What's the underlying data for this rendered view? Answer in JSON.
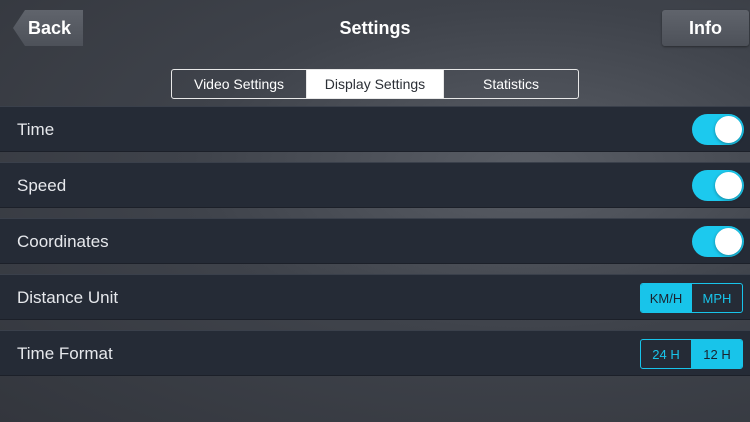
{
  "nav": {
    "back_label": "Back",
    "title": "Settings",
    "info_label": "Info"
  },
  "tabs": [
    {
      "label": "Video Settings",
      "active": false
    },
    {
      "label": "Display Settings",
      "active": true
    },
    {
      "label": "Statistics",
      "active": false
    }
  ],
  "settings": {
    "time": {
      "label": "Time",
      "enabled": true
    },
    "speed": {
      "label": "Speed",
      "enabled": true
    },
    "coordinates": {
      "label": "Coordinates",
      "enabled": true
    },
    "distance_unit": {
      "label": "Distance Unit",
      "options": [
        "KM/H",
        "MPH"
      ],
      "selected": "KM/H"
    },
    "time_format": {
      "label": "Time Format",
      "options": [
        "24 H",
        "12 H"
      ],
      "selected": "12 H"
    }
  },
  "colors": {
    "accent": "#18c4ea",
    "row_background": "#252b36"
  }
}
